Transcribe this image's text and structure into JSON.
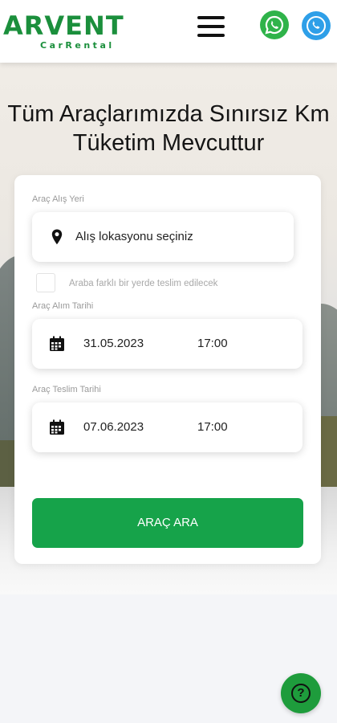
{
  "header": {
    "logo_text": "ARVENT",
    "logo_subtext": "CarRental",
    "menu_icon": "hamburger-menu-icon",
    "whatsapp_icon": "whatsapp-icon",
    "phone_icon": "phone-icon",
    "brand_color": "#1b8f3c"
  },
  "hero": {
    "title": "Tüm Araçlarımızda Sınırsız Km Tüketim Mevcuttur"
  },
  "form": {
    "pickup_location_label": "Araç Alış Yeri",
    "pickup_location_placeholder": "Alış lokasyonu seçiniz",
    "location_icon": "map-pin-icon",
    "different_dropoff_label": "Araba farklı bir yerde teslim edilecek",
    "different_dropoff_checked": false,
    "pickup_date_label": "Araç Alım Tarihi",
    "pickup_date": "31.05.2023",
    "pickup_time": "17:00",
    "return_date_label": "Araç Teslim Tarihi",
    "return_date": "07.06.2023",
    "return_time": "17:00",
    "calendar_icon": "calendar-icon",
    "search_button": "ARAÇ ARA",
    "button_color": "#16a34a"
  },
  "help": {
    "icon": "help-question-icon",
    "glyph": "?"
  }
}
